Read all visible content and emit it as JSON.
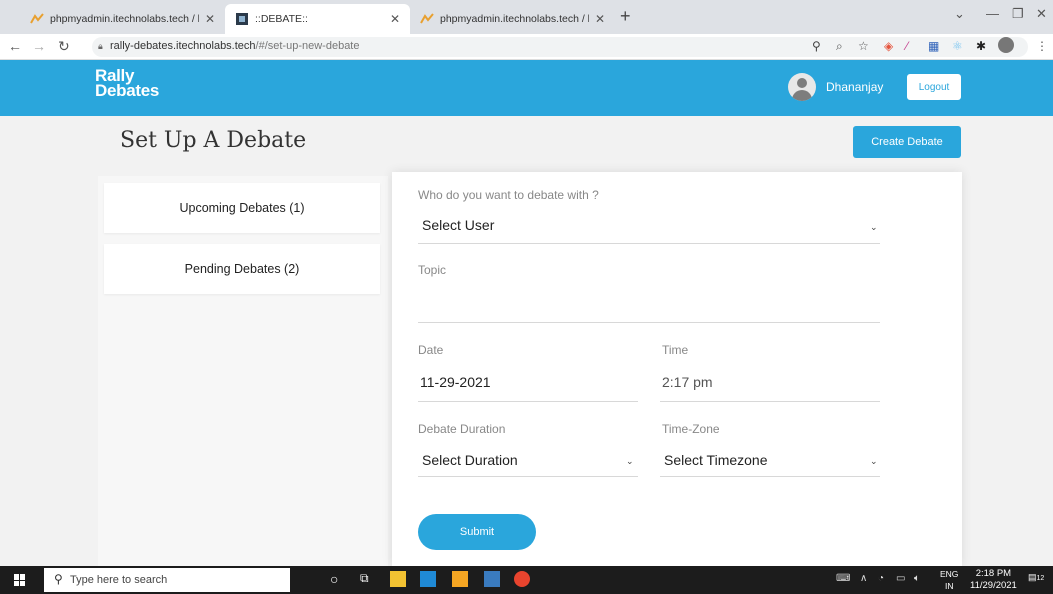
{
  "browser": {
    "tabs": [
      {
        "title": "phpmyadmin.itechnolabs.tech / l"
      },
      {
        "title": "::DEBATE::"
      },
      {
        "title": "phpmyadmin.itechnolabs.tech / l"
      }
    ],
    "url_host": "rally-debates.itechnolabs.tech",
    "url_path": "/#/set-up-new-debate"
  },
  "header": {
    "logo_line1": "Rally",
    "logo_line2": "Debates",
    "username": "Dhananjay",
    "logout_label": "Logout"
  },
  "page": {
    "title": "Set Up A Debate",
    "create_label": "Create Debate"
  },
  "sidebar": {
    "items": [
      {
        "label": "Upcoming Debates (1)"
      },
      {
        "label": "Pending Debates (2)"
      }
    ]
  },
  "form": {
    "opponent_label": "Who do you want to debate with ?",
    "opponent_value": "Select User",
    "topic_label": "Topic",
    "topic_value": "",
    "date_label": "Date",
    "date_value": "11-29-2021",
    "time_label": "Time",
    "time_value": "2:17 pm",
    "duration_label": "Debate Duration",
    "duration_value": "Select Duration",
    "timezone_label": "Time-Zone",
    "timezone_value": "Select Timezone",
    "submit_label": "Submit"
  },
  "taskbar": {
    "search_placeholder": "Type here to search",
    "lang_line1": "ENG",
    "lang_line2": "IN",
    "time": "2:18 PM",
    "date": "11/29/2021",
    "notifications": "12"
  },
  "colors": {
    "accent": "#2aa6dc",
    "taskbar": "#1c1c1c"
  }
}
